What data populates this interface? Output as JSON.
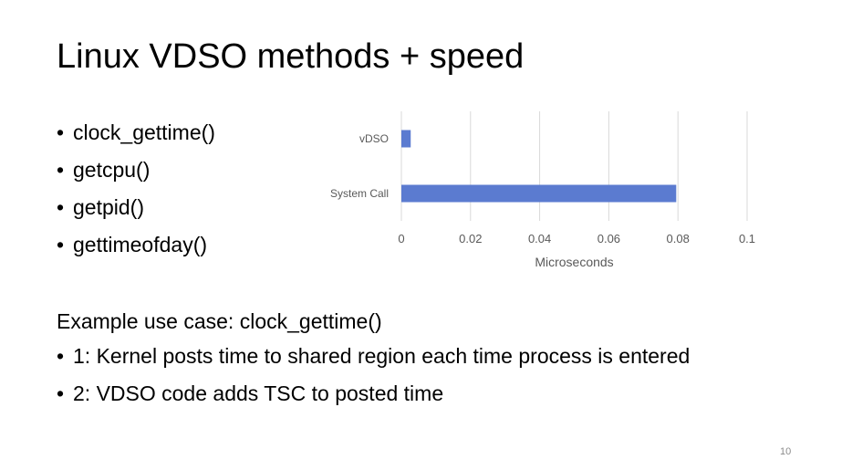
{
  "slide": {
    "title": "Linux VDSO methods + speed",
    "bullets": [
      "clock_gettime()",
      "getcpu()",
      "getpid()",
      "gettimeofday()"
    ],
    "example_heading": "Example use case: clock_gettime()",
    "steps": [
      "1: Kernel posts time to shared region each time process is entered",
      "2: VDSO code adds TSC to posted time"
    ],
    "slide_number": "10",
    "bullet_char": "•"
  },
  "chart_data": {
    "type": "bar",
    "orientation": "horizontal",
    "categories": [
      "vDSO",
      "System Call"
    ],
    "values": [
      0.0027,
      0.0795
    ],
    "xlabel": "Microseconds",
    "ylabel": "",
    "xlim": [
      0,
      0.1
    ],
    "xticks": [
      "0",
      "0.02",
      "0.04",
      "0.06",
      "0.08",
      "0.1"
    ],
    "tick_values": [
      0,
      0.02,
      0.04,
      0.06,
      0.08,
      0.1
    ],
    "grid": true,
    "legend": "none",
    "colors": {
      "bar": "#5b7bd0",
      "grid": "#d9d9d9",
      "text": "#595959"
    }
  }
}
